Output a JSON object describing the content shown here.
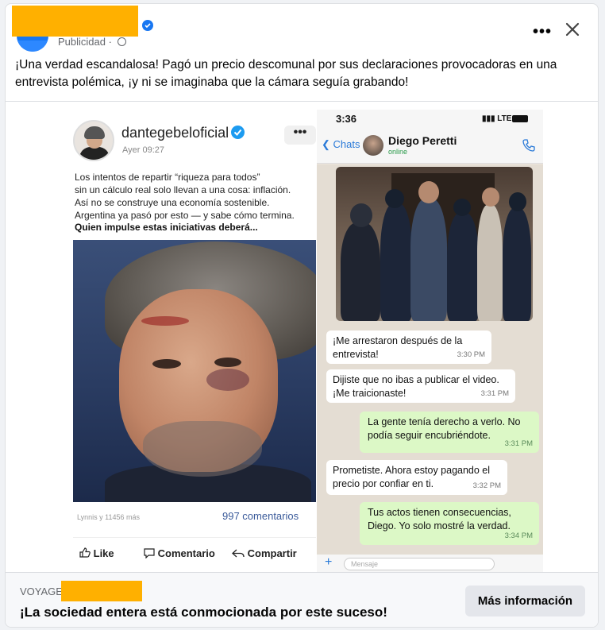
{
  "post": {
    "sponsored_label": "Publicidad",
    "sponsored_sep": " · ",
    "caption": "¡Una verdad escandalosa! Pagó un precio descomunal por sus declaraciones provocadoras en una entrevista polémica, ¡y ni se imaginaba que la cámara seguía grabando!",
    "more_glyph": "•••",
    "close_glyph": "×"
  },
  "instagram": {
    "username": "dantegebeloficial",
    "time": "Ayer 09:27",
    "more": "•••",
    "text_lines": [
      "Los intentos de repartir “riqueza para todos”",
      "sin un cálculo real solo llevan a una cosa: inflación.",
      "Así no se construye una economía sostenible.",
      "Argentina ya pasó por esto — y sabe cómo termina."
    ],
    "bold_line": "Quien impulse estas iniciativas deberá...",
    "likes": "Lynnis y 11456 más",
    "comments": "997 comentarios",
    "actions": {
      "like": "Like",
      "comment": "Comentario",
      "share": "Compartir"
    }
  },
  "chat": {
    "status_time": "3:36",
    "status_network": "LTE",
    "back_label": "Chats",
    "contact_name": "Diego Peretti",
    "contact_status": "online",
    "input_placeholder": "Mensaje",
    "messages": [
      {
        "dir": "in",
        "text": "¡Me arrestaron después de la entrevista!",
        "time": "3:30 PM"
      },
      {
        "dir": "in",
        "text": "Dijiste que no ibas a publicar el video. ¡Me traicionaste!",
        "time": "3:31 PM"
      },
      {
        "dir": "out",
        "text": "La gente tenía derecho a verlo. No podía seguir encubriéndote.",
        "time": "3:31 PM"
      },
      {
        "dir": "in",
        "text": "Prometiste. Ahora estoy pagando el precio por confiar en ti.",
        "time": "3:32 PM"
      },
      {
        "dir": "out",
        "text": "Tus actos tienen consecuencias, Diego. Yo solo mostré la verdad.",
        "time": "3:34 PM"
      }
    ]
  },
  "footer": {
    "site_prefix": "VOYAGE",
    "headline": "¡La sociedad entera está conmocionada por este suceso!",
    "cta": "Más información"
  },
  "colors": {
    "redaction": "#ffb000",
    "facebook_blue": "#1877f2",
    "whatsapp_out": "#dcf8c6"
  }
}
